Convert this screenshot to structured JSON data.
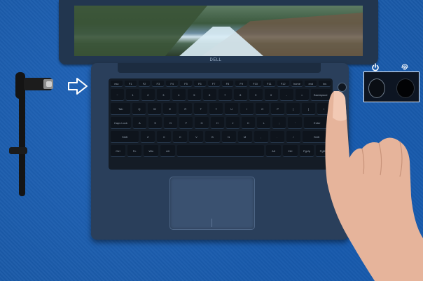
{
  "laptop": {
    "brand": "DELL",
    "keyboard": {
      "function_row": [
        "esc",
        "F1",
        "F2",
        "F3",
        "F4",
        "F5",
        "F6",
        "F7",
        "F8",
        "F9",
        "F10",
        "F11",
        "F12",
        "home",
        "end",
        "ins"
      ],
      "number_row": [
        "~",
        "1",
        "2",
        "3",
        "4",
        "5",
        "6",
        "7",
        "8",
        "9",
        "0",
        "-",
        "=",
        "Backspace"
      ],
      "top_row": [
        "Tab",
        "Q",
        "W",
        "E",
        "R",
        "T",
        "Y",
        "U",
        "I",
        "O",
        "P",
        "[",
        "]",
        "\\"
      ],
      "home_row": [
        "Caps Lock",
        "A",
        "S",
        "D",
        "F",
        "G",
        "H",
        "J",
        "K",
        "L",
        ";",
        "'",
        "Enter"
      ],
      "bottom_row": [
        "Shift",
        "Z",
        "X",
        "C",
        "V",
        "B",
        "N",
        "M",
        ",",
        ".",
        "/",
        "Shift"
      ],
      "space_row": [
        "Ctrl",
        "Fn",
        "Win",
        "Alt",
        "",
        "Alt",
        "Ctrl",
        "PgUp",
        "PgDn"
      ]
    }
  },
  "icons": {
    "power": "power-icon",
    "fingerprint": "fingerprint-icon",
    "arrow": "right-arrow-icon"
  },
  "colors": {
    "background": "#1a5aa8",
    "laptop_body": "#2a3f5b",
    "keyboard": "#141c26",
    "callout_border": "#e9eef5"
  }
}
